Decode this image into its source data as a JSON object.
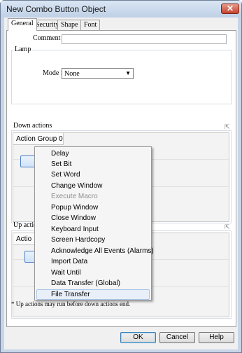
{
  "window": {
    "title": "New Combo Button Object",
    "close_glyph": "✕"
  },
  "tabs": [
    {
      "label": "General"
    },
    {
      "label": "Security"
    },
    {
      "label": "Shape"
    },
    {
      "label": "Font"
    }
  ],
  "comment": {
    "label": "Comment :",
    "value": ""
  },
  "lamp": {
    "group_label": "Lamp",
    "mode_label": "Mode :",
    "mode_value": "None"
  },
  "down_actions": {
    "group_label": "Down actions",
    "action_group_header": "Action Group 0"
  },
  "up_actions": {
    "group_label": "Up actio",
    "action_group_header": "Actio"
  },
  "context_menu": {
    "items": [
      {
        "label": "Delay",
        "enabled": true
      },
      {
        "label": "Set Bit",
        "enabled": true
      },
      {
        "label": "Set Word",
        "enabled": true
      },
      {
        "label": "Change Window",
        "enabled": true
      },
      {
        "label": "Execute Macro",
        "enabled": false
      },
      {
        "label": "Popup Window",
        "enabled": true
      },
      {
        "label": "Close Window",
        "enabled": true
      },
      {
        "label": "Keyboard Input",
        "enabled": true
      },
      {
        "label": "Screen Hardcopy",
        "enabled": true
      },
      {
        "label": "Acknowledge All Events (Alarms)",
        "enabled": true
      },
      {
        "label": "Import Data",
        "enabled": true
      },
      {
        "label": "Wait Until",
        "enabled": true
      },
      {
        "label": "Data Transfer (Global)",
        "enabled": true
      },
      {
        "label": "File Transfer",
        "enabled": true,
        "highlighted": true
      }
    ]
  },
  "footnote": "* Up actions may run before down actions end.",
  "buttons": {
    "ok": "OK",
    "cancel": "Cancel",
    "help": "Help"
  },
  "icons": {
    "add": "+",
    "popout": "⇱",
    "dropdown": "▼"
  }
}
